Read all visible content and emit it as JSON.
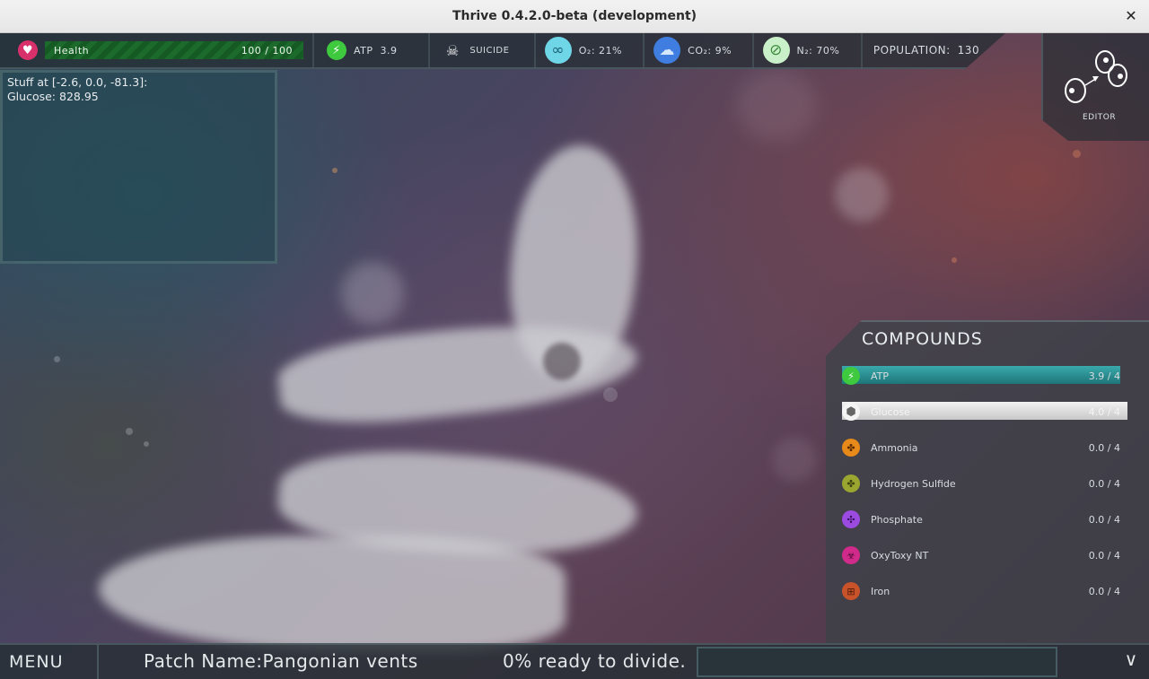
{
  "window": {
    "title": "Thrive 0.4.2.0-beta (development)",
    "close_glyph": "✕"
  },
  "hud": {
    "health": {
      "label": "Health",
      "value": "100 / 100",
      "icon": "heart-icon",
      "fraction": 1.0
    },
    "atp": {
      "label": "ATP",
      "value": "3.9",
      "icon": "lightning-icon"
    },
    "suicide": {
      "label": "SUICIDE",
      "icon": "skull-icon"
    },
    "oxygen": {
      "label": "O₂: 21%",
      "icon": "bubbles-icon"
    },
    "co2": {
      "label": "CO₂: 9%",
      "icon": "cloud-icon"
    },
    "nitrogen": {
      "label": "N₂: 70%",
      "icon": "nitrogen-icon"
    },
    "population": {
      "label": "POPULATION:",
      "value": "130"
    }
  },
  "editor": {
    "label": "EDITOR",
    "icon": "editor-cells-icon"
  },
  "info": {
    "line1": "Stuff at [-2.6, 0.0, -81.3]:",
    "line2": "Glucose: 828.95"
  },
  "compounds": {
    "title": "COMPOUNDS",
    "items": [
      {
        "name": "ATP",
        "value": "3.9 / 4",
        "icon": "lightning-icon",
        "color": "#3ec93e",
        "bar_color": "#2a8f93",
        "fraction": 0.975
      },
      {
        "name": "Glucose",
        "value": "4.0 / 4",
        "icon": "glucose-icon",
        "color": "#eeeeee",
        "bar_color": "#e8e8e8",
        "fraction": 1.0
      },
      {
        "name": "Ammonia",
        "value": "0.0 / 4",
        "icon": "ammonia-icon",
        "color": "#e88a1a",
        "fraction": 0
      },
      {
        "name": "Hydrogen Sulfide",
        "value": "0.0 / 4",
        "icon": "hydrogen-sulfide-icon",
        "color": "#9aa630",
        "fraction": 0
      },
      {
        "name": "Phosphate",
        "value": "0.0 / 4",
        "icon": "phosphate-icon",
        "color": "#9b4be0",
        "fraction": 0
      },
      {
        "name": "OxyToxy NT",
        "value": "0.0 / 4",
        "icon": "oxytoxy-icon",
        "color": "#d02a8a",
        "fraction": 0
      },
      {
        "name": "Iron",
        "value": "0.0 / 4",
        "icon": "iron-icon",
        "color": "#c8522a",
        "fraction": 0
      }
    ]
  },
  "bottom": {
    "menu": "MENU",
    "patch": "Patch Name:Pangonian vents",
    "divide": "0% ready to divide.",
    "collapse_glyph": "∨"
  }
}
